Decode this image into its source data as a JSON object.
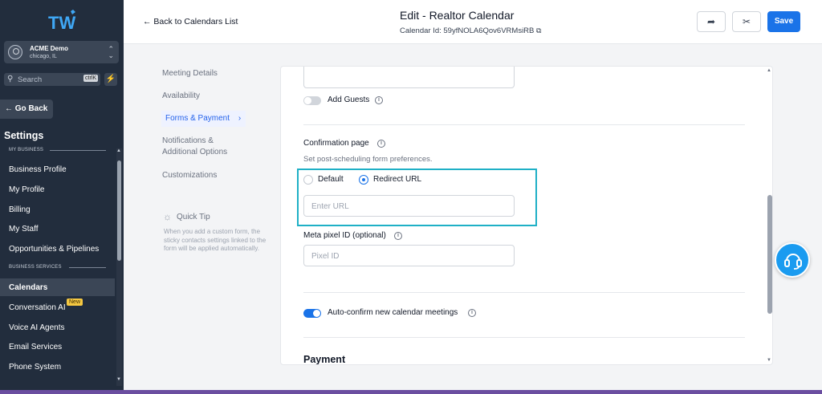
{
  "sidebar": {
    "account": {
      "name": "ACME Demo",
      "location": "chicago, IL"
    },
    "search": {
      "placeholder": "Search",
      "shortcut": "ctrlK"
    },
    "go_back": "Go Back",
    "settings_title": "Settings",
    "sections": [
      {
        "label": "MY BUSINESS"
      },
      {
        "label": "BUSINESS SERVICES"
      }
    ],
    "items": [
      {
        "label": "Business Profile"
      },
      {
        "label": "My Profile"
      },
      {
        "label": "Billing"
      },
      {
        "label": "My Staff"
      },
      {
        "label": "Opportunities & Pipelines"
      },
      {
        "label": "Calendars",
        "active": true
      },
      {
        "label": "Conversation AI",
        "badge": "New"
      },
      {
        "label": "Voice AI Agents"
      },
      {
        "label": "Email Services"
      },
      {
        "label": "Phone System"
      }
    ]
  },
  "header": {
    "back_label": "Back to Calendars List",
    "title": "Edit - Realtor Calendar",
    "calendar_id": "Calendar Id: 59yfNOLA6Qov6VRMsiRB",
    "save_label": "Save"
  },
  "subnav": {
    "items": [
      {
        "label": "Meeting Details"
      },
      {
        "label": "Availability"
      },
      {
        "label": "Forms & Payment",
        "active": true
      },
      {
        "label": "Notifications &"
      },
      {
        "label": "Additional Options"
      },
      {
        "label": "Customizations"
      }
    ],
    "quick_tip_title": "Quick Tip",
    "quick_tip_text": "When you add a custom form, the sticky contacts settings linked to the form will be applied automatically."
  },
  "form": {
    "add_guests_label": "Add Guests",
    "add_guests_enabled": false,
    "confirmation_title": "Confirmation page",
    "confirmation_help": "Set post-scheduling form preferences.",
    "radio_default": "Default",
    "radio_redirect": "Redirect URL",
    "selected_option": "Redirect URL",
    "url_placeholder": "Enter URL",
    "meta_pixel_label": "Meta pixel ID (optional)",
    "pixel_placeholder": "Pixel ID",
    "auto_confirm_label": "Auto-confirm new calendar meetings",
    "auto_confirm_enabled": true,
    "payment_title": "Payment"
  },
  "colors": {
    "accent": "#1a73e8",
    "sidebar_bg": "#222d3d",
    "highlight": "#1fb0c6",
    "badge": "#f5c842"
  }
}
